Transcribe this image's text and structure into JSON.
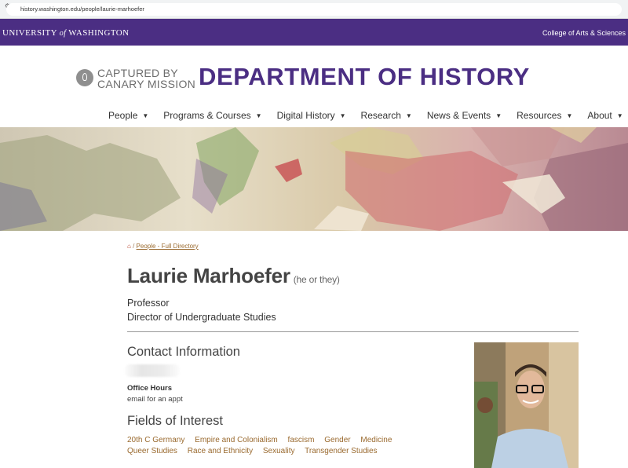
{
  "browser": {
    "url": "history.washington.edu/people/laurie-marhoefer"
  },
  "uw_bar": {
    "university_left": "UNIVERSITY",
    "university_of": "of",
    "university_right": "WASHINGTON",
    "college": "College of Arts & Sciences"
  },
  "header": {
    "canary_line1": "CAPTURED BY",
    "canary_line2": "CANARY MISSION",
    "department": "DEPARTMENT OF HISTORY"
  },
  "nav": {
    "items": [
      {
        "label": "People"
      },
      {
        "label": "Programs & Courses"
      },
      {
        "label": "Digital History"
      },
      {
        "label": "Research"
      },
      {
        "label": "News & Events"
      },
      {
        "label": "Resources"
      },
      {
        "label": "About"
      }
    ]
  },
  "breadcrumb": {
    "separator": "/",
    "link": "People - Full Directory"
  },
  "profile": {
    "name": "Laurie Marhoefer",
    "pronouns": "(he or they)",
    "title1": "Professor",
    "title2": "Director of Undergraduate Studies",
    "contact_heading": "Contact Information",
    "office_hours_label": "Office Hours",
    "office_hours_value": "email for an appt",
    "fields_heading": "Fields of Interest",
    "fields": [
      "20th C Germany",
      "Empire and Colonialism",
      "fascism",
      "Gender",
      "Medicine",
      "Queer Studies",
      "Race and Ethnicity",
      "Sexuality",
      "Transgender Studies"
    ]
  },
  "colors": {
    "uw_purple": "#4b2e83",
    "link_gold": "#9a6a2f",
    "home_icon": "#b5371f"
  }
}
